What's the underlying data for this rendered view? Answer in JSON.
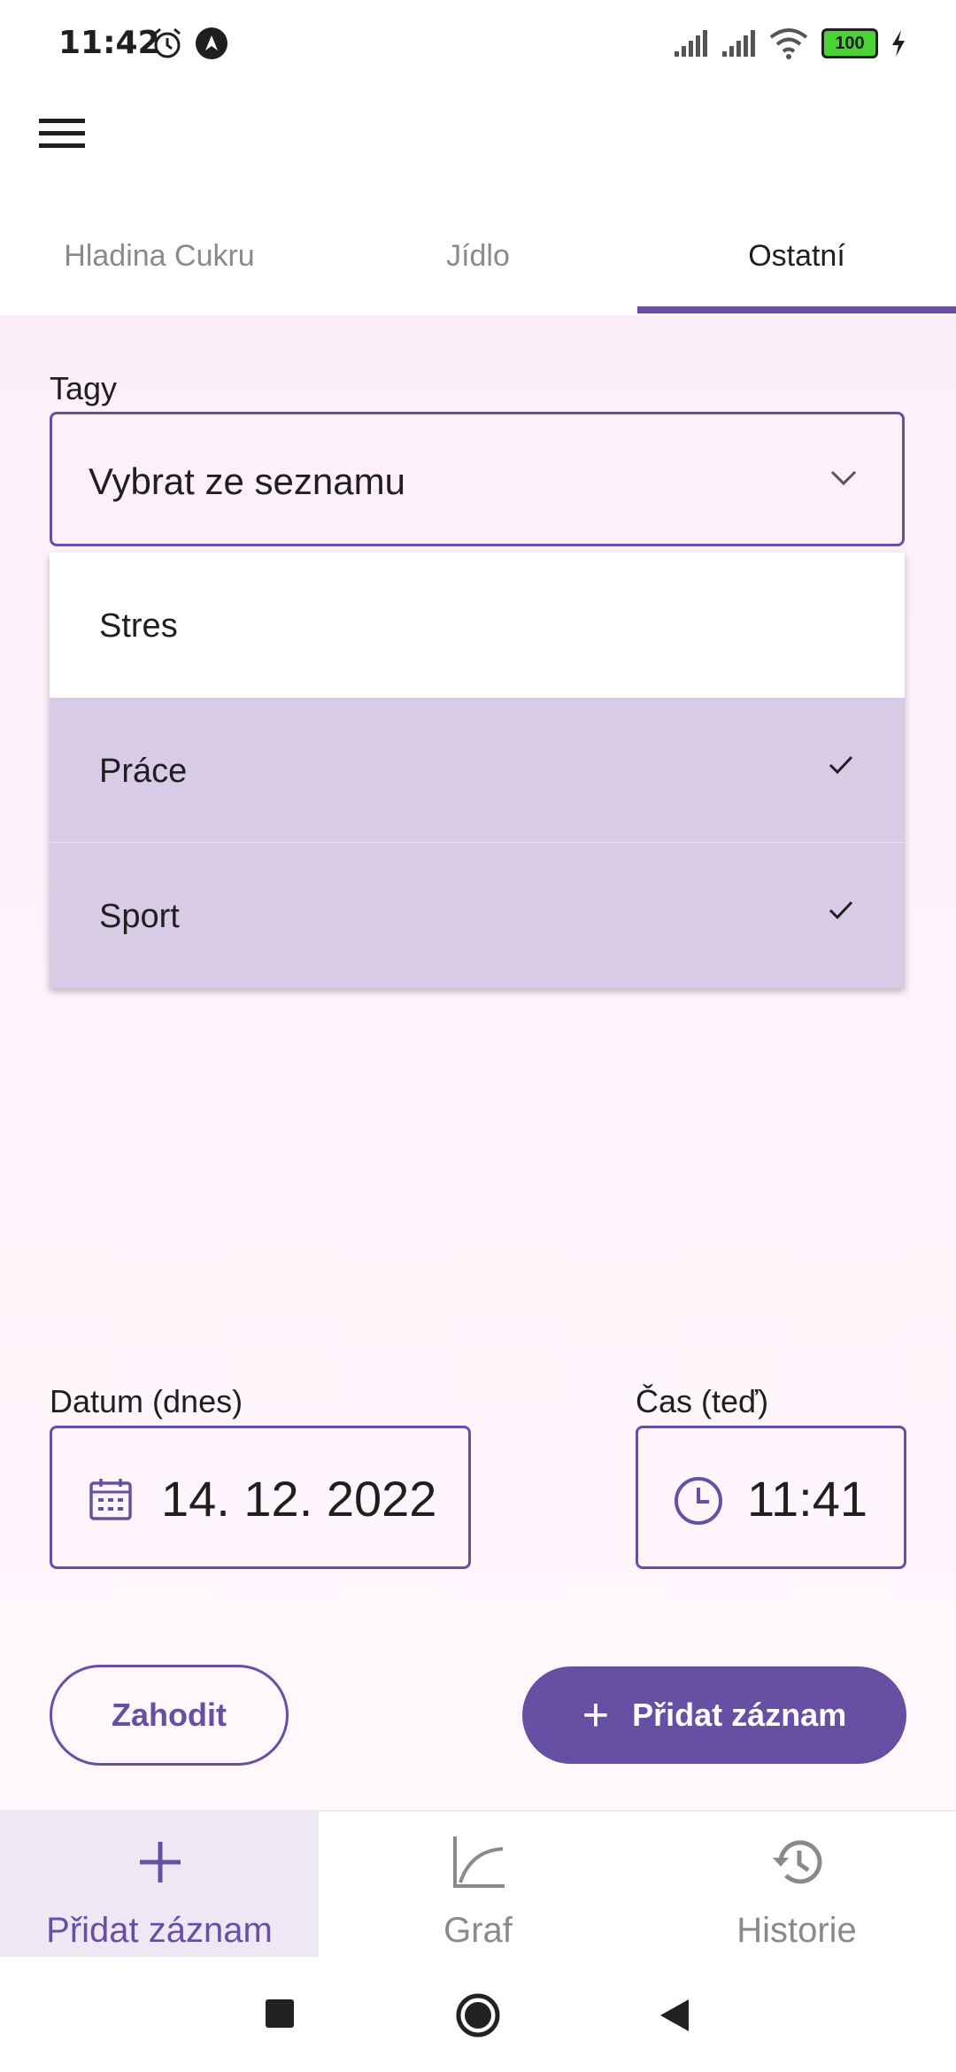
{
  "status_bar": {
    "time": "11:42",
    "battery": "100"
  },
  "tabs": [
    {
      "label": "Hladina Cukru",
      "active": false
    },
    {
      "label": "Jídlo",
      "active": false
    },
    {
      "label": "Ostatní",
      "active": true
    }
  ],
  "tags": {
    "label": "Tagy",
    "placeholder": "Vybrat ze seznamu",
    "options": [
      {
        "label": "Stres",
        "selected": false
      },
      {
        "label": "Práce",
        "selected": true
      },
      {
        "label": "Sport",
        "selected": true
      }
    ]
  },
  "datetime": {
    "date_label": "Datum (dnes)",
    "date_value": "14. 12. 2022",
    "time_label": "Čas (teď)",
    "time_value": "11:41"
  },
  "actions": {
    "discard_label": "Zahodit",
    "add_label": "Přidat záznam"
  },
  "bottom_nav": [
    {
      "label": "Přidat záznam",
      "icon": "plus-icon",
      "active": true
    },
    {
      "label": "Graf",
      "icon": "graph-icon",
      "active": false
    },
    {
      "label": "Historie",
      "icon": "history-icon",
      "active": false
    }
  ],
  "colors": {
    "primary": "#6750a4",
    "selected_option": "#d8cbe6",
    "background": "#fdeffa"
  }
}
